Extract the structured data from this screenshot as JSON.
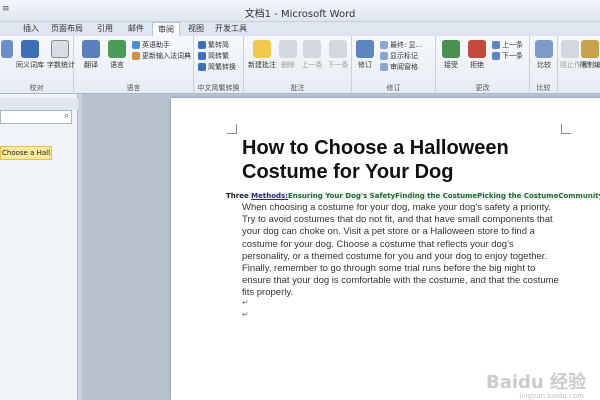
{
  "window": {
    "title": "文档1 - Microsoft Word",
    "quick_access": "≡"
  },
  "tabs": [
    "插入",
    "页面布局",
    "引用",
    "邮件",
    "审阅",
    "视图",
    "开发工具"
  ],
  "active_tab": "审阅",
  "ribbon": {
    "proofing": {
      "label": "校对",
      "items": [
        "息\n检索",
        "同义词库",
        "字数统计"
      ]
    },
    "language": {
      "label": "语言",
      "items": [
        "翻译",
        "语言"
      ],
      "small": [
        "英语助手",
        "更新输入法词典"
      ]
    },
    "chinese": {
      "label": "中文简繁转换",
      "items": [
        "繁转简",
        "简转繁",
        "简繁转换"
      ]
    },
    "comments": {
      "label": "批注",
      "items": [
        "新建批注",
        "删除",
        "上一条",
        "下一条"
      ]
    },
    "tracking": {
      "label": "修订",
      "items": [
        "修订"
      ],
      "small": [
        "最终: 显...",
        "显示标记",
        "审阅窗格"
      ]
    },
    "changes": {
      "label": "更改",
      "items": [
        "接受",
        "拒绝"
      ],
      "small": [
        "上一条",
        "下一条"
      ]
    },
    "compare": {
      "label": "比较",
      "items": [
        "比较"
      ]
    },
    "protect": {
      "label": "保护",
      "items": [
        "阻止作者",
        "限制编辑"
      ]
    }
  },
  "nav": {
    "search_icon": "⌕",
    "item": "Choose a Hall..."
  },
  "document": {
    "title": "How to Choose a Halloween Costume for Your Dog",
    "methods_prefix": "Three ",
    "methods_word": "Methods:",
    "methods_rest": "Ensuring Your Dog's SafetyFinding the CostumePicking the CostumeCommunity Q&A",
    "body": "When choosing a costume for your dog, make your dog's safety a priority. Try to avoid costumes that do not fit, and that have small components that your dog can choke on. Visit a pet store or a Halloween store to find a costume for your dog. Choose a costume that reflects your dog's personality, or a themed costume for you and your dog to enjoy together. Finally, remember to go through some trial runs before the big night to ensure that your dog is comfortable with the costume, and that the costume fits properly.",
    "para_mark": "↵"
  },
  "watermark": {
    "brand": "Baidu 经验",
    "url": "jingyan.baidu.com"
  }
}
